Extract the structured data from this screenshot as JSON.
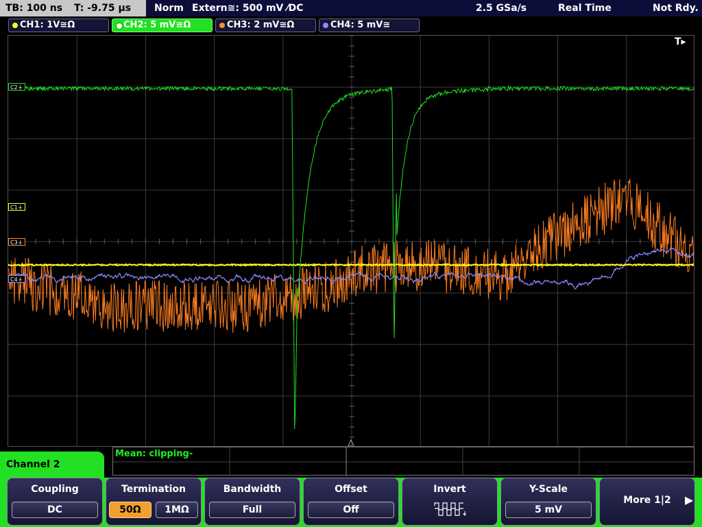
{
  "status": {
    "timebase": "TB: 100 ns",
    "trigger_time": "T: -9.75 µs",
    "mode": "Norm",
    "trigger_source": "Extern≅: 500 mV ⁄DC",
    "sample_rate": "2.5 GSa/s",
    "acq_mode": "Real Time",
    "ready": "Not Rdy."
  },
  "channels": [
    {
      "label": "CH1: 1V≅Ω",
      "color": "#ffff20"
    },
    {
      "label": "CH2: 5 mV≅Ω",
      "color": "#22e022",
      "active": true
    },
    {
      "label": "CH3: 2 mV≅Ω",
      "color": "#ff8c30"
    },
    {
      "label": "CH4: 5 mV≅",
      "color": "#8a8aff"
    }
  ],
  "screen": {
    "trigger_marker": "T▸",
    "markers": {
      "c1": "C1⏚",
      "c2": "C2⏚",
      "c3": "C3⏚",
      "c4": "C4⏚"
    }
  },
  "measurement": "Mean: clipping-",
  "panel_title": "Channel 2",
  "softkeys": {
    "coupling": {
      "label": "Coupling",
      "value": "DC"
    },
    "termination": {
      "label": "Termination",
      "opt1": "50Ω",
      "opt2": "1MΩ"
    },
    "bandwidth": {
      "label": "Bandwidth",
      "value": "Full"
    },
    "offset": {
      "label": "Offset",
      "value": "Off"
    },
    "invert": {
      "label": "Invert"
    },
    "yscale": {
      "label": "Y-Scale",
      "value": "5 mV"
    },
    "more": {
      "label": "More 1|2"
    }
  }
}
